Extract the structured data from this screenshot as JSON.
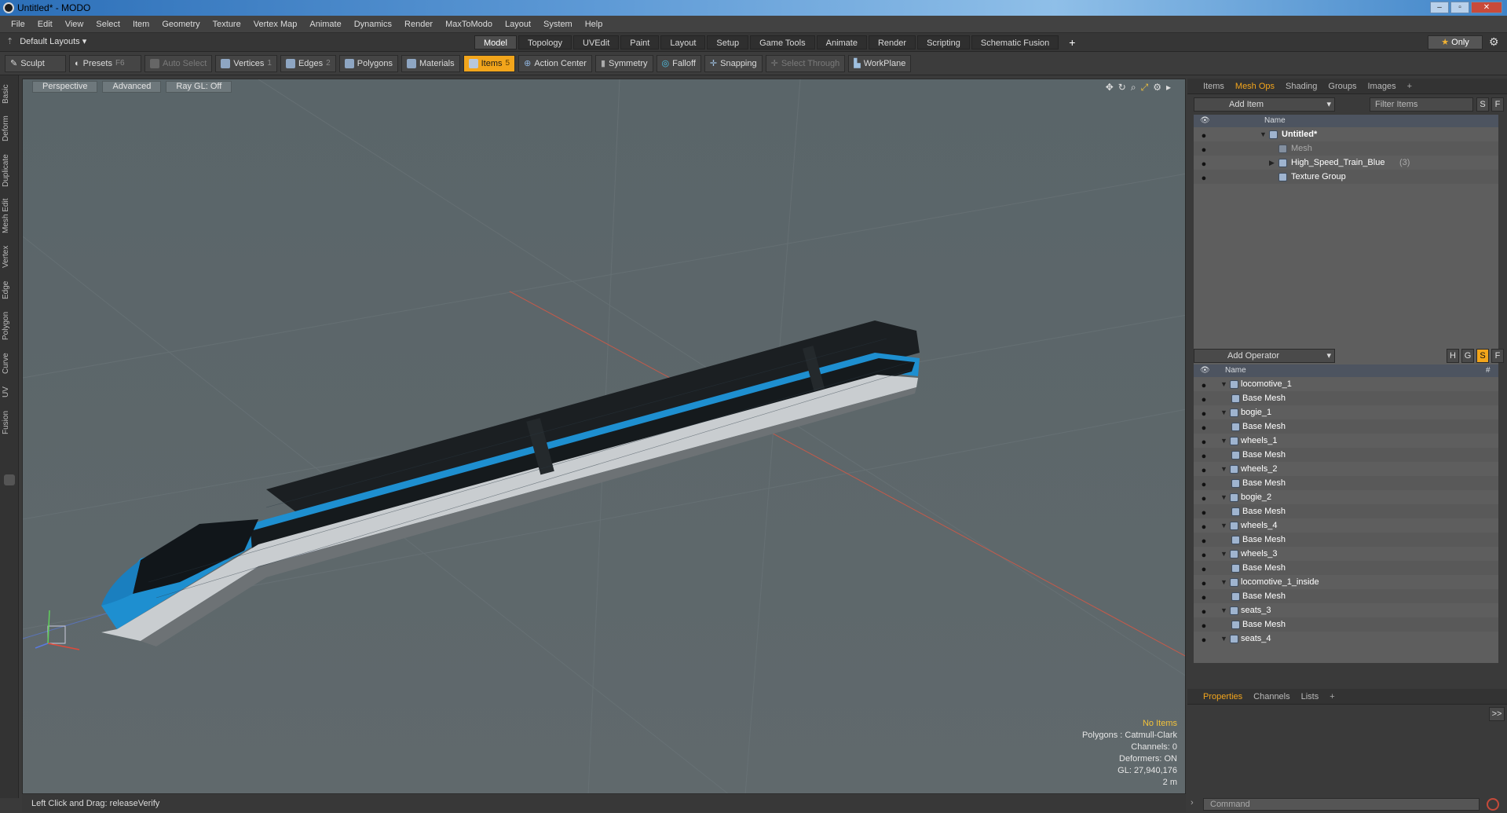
{
  "window": {
    "title": "Untitled* - MODO"
  },
  "menu": [
    "File",
    "Edit",
    "View",
    "Select",
    "Item",
    "Geometry",
    "Texture",
    "Vertex Map",
    "Animate",
    "Dynamics",
    "Render",
    "MaxToModo",
    "Layout",
    "System",
    "Help"
  ],
  "layout": {
    "name": "Default Layouts",
    "tabs": [
      "Model",
      "Topology",
      "UVEdit",
      "Paint",
      "Layout",
      "Setup",
      "Game Tools",
      "Animate",
      "Render",
      "Scripting",
      "Schematic Fusion"
    ],
    "active_tab": "Model",
    "plus": "+",
    "only": "Only"
  },
  "toolbar": {
    "sculpt": "Sculpt",
    "presets": "Presets",
    "presets_key": "F6",
    "auto_select": "Auto Select",
    "vertices": "Vertices",
    "vertices_key": "1",
    "edges": "Edges",
    "edges_key": "2",
    "polygons": "Polygons",
    "materials": "Materials",
    "items": "Items",
    "items_key": "5",
    "action_center": "Action Center",
    "symmetry": "Symmetry",
    "falloff": "Falloff",
    "snapping": "Snapping",
    "select_through": "Select Through",
    "workplane": "WorkPlane"
  },
  "left_tabs": [
    "Basic",
    "Deform",
    "Duplicate",
    "Mesh Edit",
    "Vertex",
    "Edge",
    "Polygon",
    "Curve",
    "UV",
    "Fusion"
  ],
  "viewport": {
    "view": "Perspective",
    "shading": "Advanced",
    "raygl": "Ray GL: Off",
    "info": {
      "items": "No Items",
      "polygons": "Polygons : Catmull-Clark",
      "channels": "Channels: 0",
      "deformers": "Deformers: ON",
      "gl": "GL: 27,940,176",
      "scale": "2 m"
    }
  },
  "items_panel": {
    "tabs": [
      "Items",
      "Mesh Ops",
      "Shading",
      "Groups",
      "Images"
    ],
    "active_tab": "Mesh Ops",
    "plus": "+",
    "add_item": "Add Item",
    "filter": "Filter Items",
    "s": "S",
    "f": "F",
    "col_name": "Name",
    "rows": [
      {
        "label": "Untitled*",
        "count": ""
      },
      {
        "label": "Mesh",
        "count": ""
      },
      {
        "label": "High_Speed_Train_Blue",
        "count": "(3)"
      },
      {
        "label": "Texture Group",
        "count": ""
      }
    ]
  },
  "ops_panel": {
    "add_operator": "Add Operator",
    "h": "H",
    "g": "G",
    "s": "S",
    "f": "F",
    "col_name": "Name",
    "col_hash": "#",
    "rows": [
      "locomotive_1",
      "Base Mesh",
      "bogie_1",
      "Base Mesh",
      "wheels_1",
      "Base Mesh",
      "wheels_2",
      "Base Mesh",
      "bogie_2",
      "Base Mesh",
      "wheels_4",
      "Base Mesh",
      "wheels_3",
      "Base Mesh",
      "locomotive_1_inside",
      "Base Mesh",
      "seats_3",
      "Base Mesh",
      "seats_4"
    ]
  },
  "props_panel": {
    "tabs": [
      "Properties",
      "Channels",
      "Lists"
    ],
    "active_tab": "Properties",
    "plus": "+",
    "expand": ">>"
  },
  "status": {
    "text": "Left Click and Drag:  releaseVerify"
  },
  "command": {
    "placeholder": "Command"
  },
  "colors": {
    "accent": "#f2a51b",
    "train_blue": "#1e8fd0",
    "viewport_bg": "#5c676b"
  }
}
